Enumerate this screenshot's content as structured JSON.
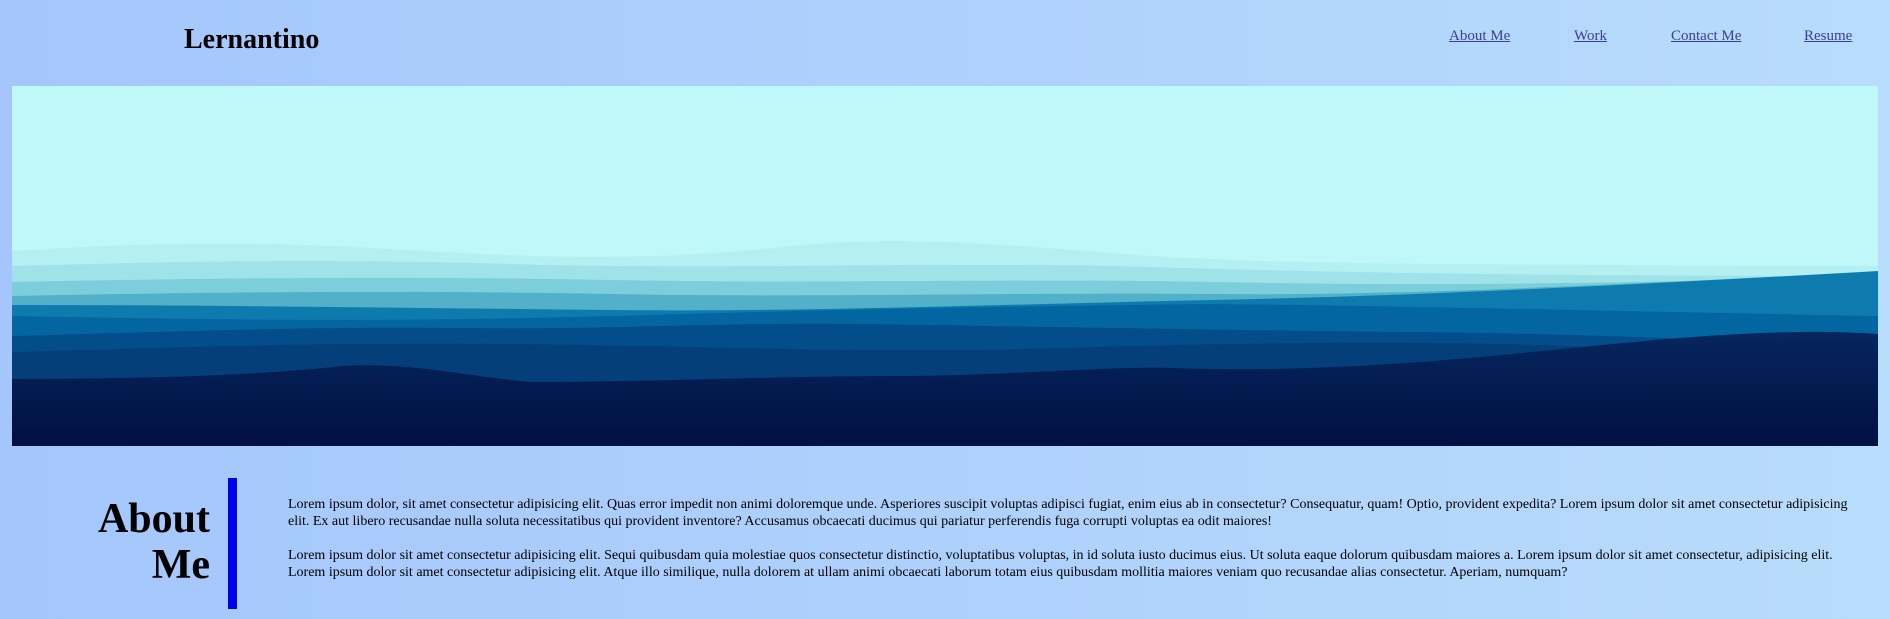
{
  "header": {
    "logo": "Lernantino",
    "nav": [
      {
        "label": "About Me"
      },
      {
        "label": "Work"
      },
      {
        "label": "Contact Me"
      },
      {
        "label": "Resume"
      }
    ]
  },
  "about": {
    "title_line1": "About",
    "title_line2": "Me",
    "paragraphs": [
      "Lorem ipsum dolor, sit amet consectetur adipisicing elit. Quas error impedit non animi doloremque unde. Asperiores suscipit voluptas adipisci fugiat, enim eius ab in consectetur? Consequatur, quam! Optio, provident expedita? Lorem ipsum dolor sit amet consectetur adipisicing elit. Ex aut libero recusandae nulla soluta necessitatibus qui provident inventore? Accusamus obcaecati ducimus qui pariatur perferendis fuga corrupti voluptas ea odit maiores!",
      "Lorem ipsum dolor sit amet consectetur adipisicing elit. Sequi quibusdam quia molestiae quos consectetur distinctio, voluptatibus voluptas, in id soluta iusto ducimus eius. Ut soluta eaque dolorum quibusdam maiores a. Lorem ipsum dolor sit amet consectetur, adipisicing elit. Lorem ipsum dolor sit amet consectetur adipisicing elit. Atque illo similique, nulla dolorem at ullam animi obcaecati laborum totam eius quibusdam mollitia maiores veniam quo recusandae alias consectetur. Aperiam, numquam?"
    ]
  },
  "colors": {
    "background": "#aed1fc",
    "sky": "#c0f7f8",
    "accent_bar": "#0000ee",
    "nav_link": "#3d3d9a",
    "deep_wave": "#03154a"
  }
}
